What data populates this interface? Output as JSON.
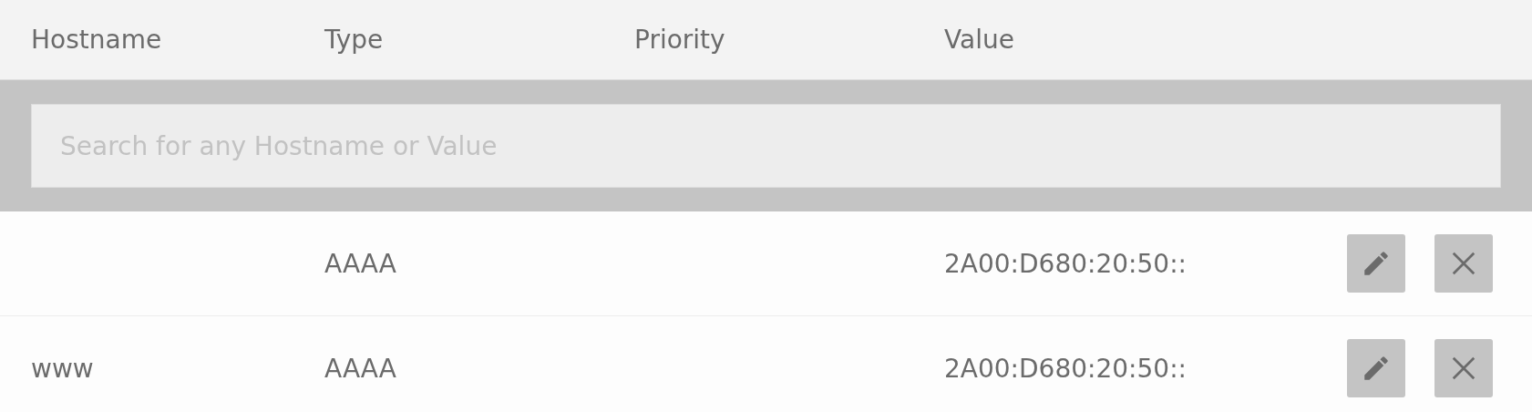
{
  "table": {
    "columns": [
      "Hostname",
      "Type",
      "Priority",
      "Value"
    ],
    "search": {
      "placeholder": "Search for any Hostname or Value"
    },
    "rows": [
      {
        "hostname": "",
        "type": "AAAA",
        "priority": "",
        "value": "2A00:D680:20:50::"
      },
      {
        "hostname": "www",
        "type": "AAAA",
        "priority": "",
        "value": "2A00:D680:20:50::"
      }
    ]
  }
}
